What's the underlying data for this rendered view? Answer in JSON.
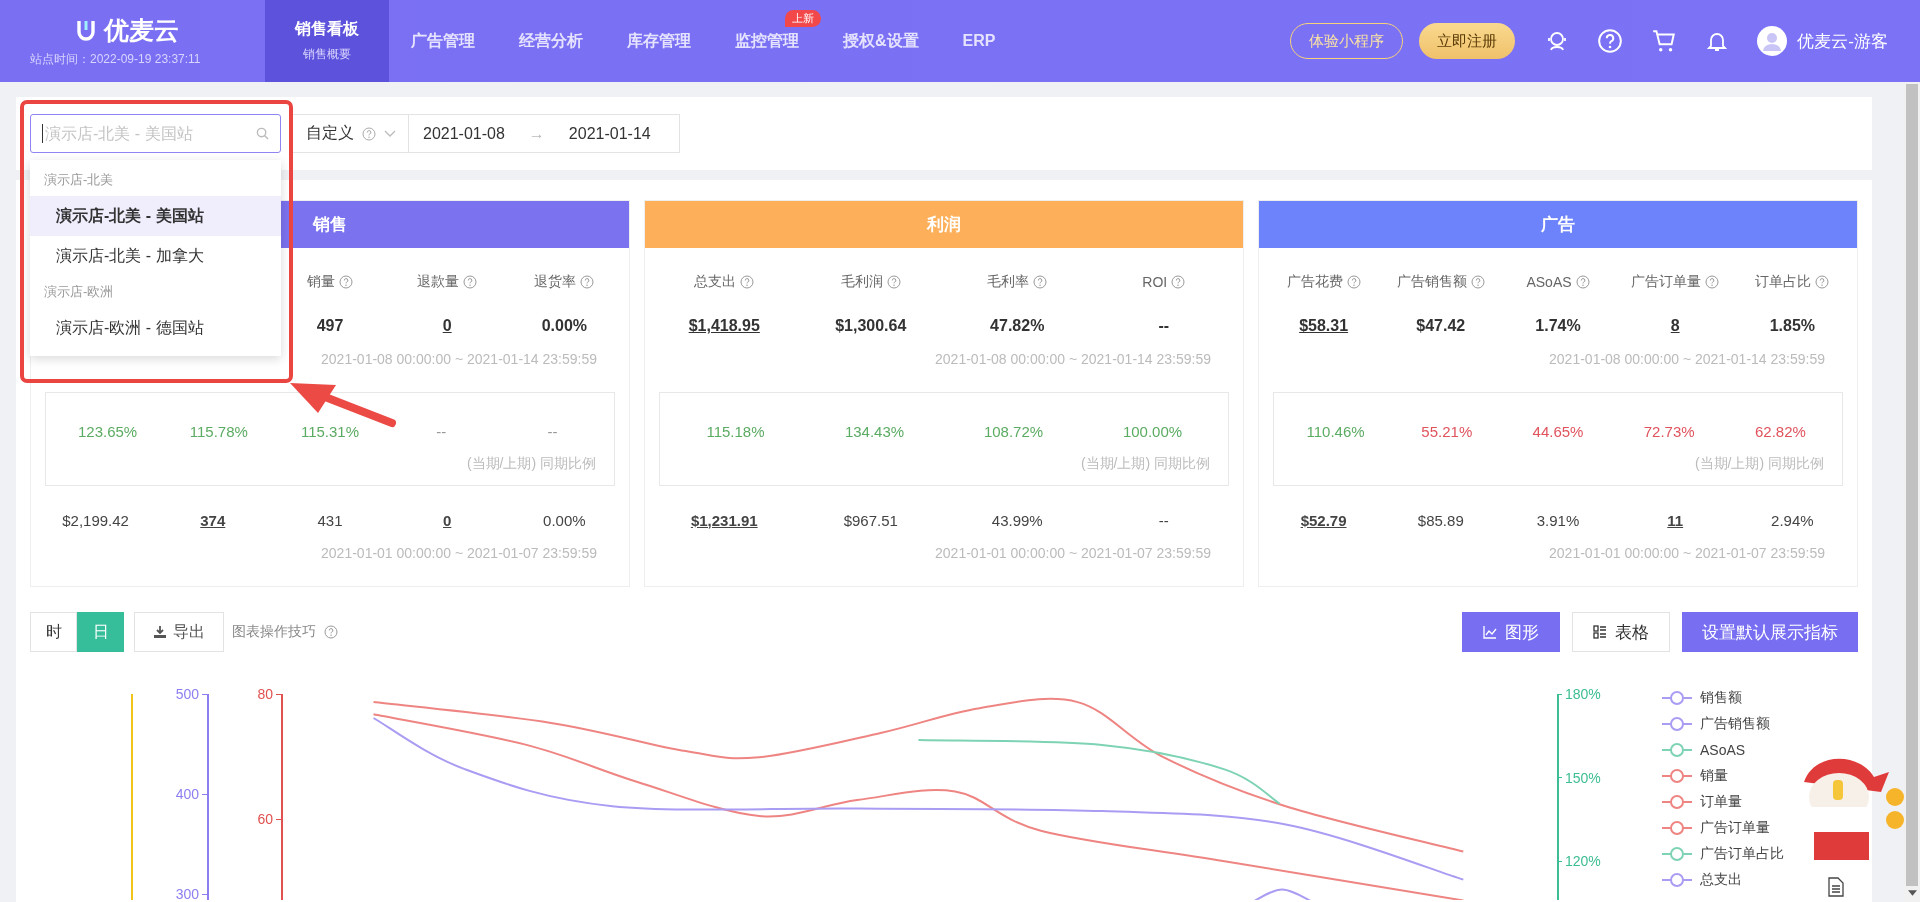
{
  "header": {
    "logo": "优麦云",
    "site_time": "站点时间：2022-09-19 23:37:11",
    "nav": [
      {
        "label": "销售看板",
        "sub": "销售概要",
        "selected": true
      },
      {
        "label": "广告管理",
        "selected": false
      },
      {
        "label": "经营分析",
        "selected": false
      },
      {
        "label": "库存管理",
        "selected": false
      },
      {
        "label": "监控管理",
        "badge": "上新",
        "selected": false
      },
      {
        "label": "授权&设置",
        "selected": false
      },
      {
        "label": "ERP",
        "selected": false
      }
    ],
    "mini_program_button": "体验小程序",
    "register_button": "立即注册",
    "user_name": "优麦云-游客"
  },
  "filter": {
    "store_search": {
      "placeholder": "演示店-北美 - 美国站"
    },
    "period_select": "自定义",
    "date_from": "2021-01-08",
    "date_arrow": "→",
    "date_to": "2021-01-14"
  },
  "store_dropdown": {
    "groups": [
      {
        "name": "演示店-北美",
        "items": [
          {
            "label": "演示店-北美 - 美国站",
            "selected": true
          },
          {
            "label": "演示店-北美 - 加拿大",
            "selected": false
          }
        ]
      },
      {
        "name": "演示店-欧洲",
        "items": [
          {
            "label": "演示店-欧洲 - 德国站",
            "selected": false
          }
        ]
      }
    ]
  },
  "cards": [
    {
      "title": "销售",
      "color": "#7b72ef",
      "current_range": "2021-01-08 00:00:00 ~ 2021-01-14 23:59:59",
      "ratio_note": "(当期/上期) 同期比例",
      "previous_range": "2021-01-01 00:00:00 ~ 2021-01-07 23:59:59",
      "metrics": [
        {
          "ratio": "123.65%",
          "color": "#5bab62",
          "previous": "$2,199.42",
          "linked": false
        },
        {
          "ratio": "115.78%",
          "color": "#5bab62",
          "previous": "374",
          "linked": true
        },
        {
          "label": "销量",
          "current": "497",
          "ratio": "115.31%",
          "color": "#5bab62",
          "previous": "431",
          "linked": false
        },
        {
          "label": "退款量",
          "current": "0",
          "ratio": "--",
          "color": "#999999",
          "previous": "0",
          "linked": true
        },
        {
          "label": "退货率",
          "current": "0.00%",
          "ratio": "--",
          "color": "#999999",
          "previous": "0.00%",
          "linked": false
        }
      ]
    },
    {
      "title": "利润",
      "color": "#fdb059",
      "current_range": "2021-01-08 00:00:00 ~ 2021-01-14 23:59:59",
      "ratio_note": "(当期/上期) 同期比例",
      "previous_range": "2021-01-01 00:00:00 ~ 2021-01-07 23:59:59",
      "metrics": [
        {
          "label": "总支出",
          "current": "$1,418.95",
          "ratio": "115.18%",
          "color": "#5bab62",
          "previous": "$1,231.91",
          "linked": true
        },
        {
          "label": "毛利润",
          "current": "$1,300.64",
          "ratio": "134.43%",
          "color": "#5bab62",
          "previous": "$967.51",
          "linked": false
        },
        {
          "label": "毛利率",
          "current": "47.82%",
          "ratio": "108.72%",
          "color": "#5bab62",
          "previous": "43.99%",
          "linked": false
        },
        {
          "label": "ROI",
          "current": "--",
          "ratio": "100.00%",
          "color": "#5bab62",
          "previous": "--",
          "linked": false
        }
      ]
    },
    {
      "title": "广告",
      "color": "#6d83fb",
      "current_range": "2021-01-08 00:00:00 ~ 2021-01-14 23:59:59",
      "ratio_note": "(当期/上期) 同期比例",
      "previous_range": "2021-01-01 00:00:00 ~ 2021-01-07 23:59:59",
      "metrics": [
        {
          "label": "广告花费",
          "current": "$58.31",
          "ratio": "110.46%",
          "color": "#5bab62",
          "previous": "$52.79",
          "linked": true
        },
        {
          "label": "广告销售额",
          "current": "$47.42",
          "ratio": "55.21%",
          "color": "#e0535d",
          "previous": "$85.89",
          "linked": false
        },
        {
          "label": "ASoAS",
          "current": "1.74%",
          "ratio": "44.65%",
          "color": "#e0535d",
          "previous": "3.91%",
          "linked": false
        },
        {
          "label": "广告订单量",
          "current": "8",
          "ratio": "72.73%",
          "color": "#e0535d",
          "previous": "11",
          "linked": true
        },
        {
          "label": "订单占比",
          "current": "1.85%",
          "ratio": "62.82%",
          "color": "#e0535d",
          "previous": "2.94%",
          "linked": false
        }
      ]
    }
  ],
  "chart": {
    "granularity": [
      {
        "label": "时",
        "selected": false
      },
      {
        "label": "日",
        "selected": true
      }
    ],
    "export_button": "导出",
    "tips": "图表操作技巧",
    "views": [
      {
        "label": "图形",
        "kind": "chart",
        "selected": true
      },
      {
        "label": "表格",
        "kind": "table",
        "selected": false
      }
    ],
    "default_metrics_button": "设置默认展示指标",
    "axes": [
      {
        "kind": "plain",
        "color": "#f0c419"
      },
      {
        "kind": "left",
        "color": "#8c7ef0",
        "ticks": [
          "500",
          "400",
          "300"
        ]
      },
      {
        "kind": "left",
        "color": "#e0514f",
        "ticks": [
          "80",
          "60"
        ]
      },
      {
        "kind": "right",
        "color": "#3dbd94",
        "ticks": [
          "180%",
          "150%",
          "120%"
        ]
      }
    ],
    "legend": [
      {
        "label": "销售额",
        "color": "#a99cf3"
      },
      {
        "label": "广告销售额",
        "color": "#a99cf3"
      },
      {
        "label": "ASoAS",
        "color": "#7dd3b3"
      },
      {
        "label": "销量",
        "color": "#ee8582"
      },
      {
        "label": "订单量",
        "color": "#ee8582"
      },
      {
        "label": "广告订单量",
        "color": "#ee8582"
      },
      {
        "label": "广告订单占比",
        "color": "#7dd3b3"
      },
      {
        "label": "总支出",
        "color": "#a99cf3"
      }
    ]
  }
}
